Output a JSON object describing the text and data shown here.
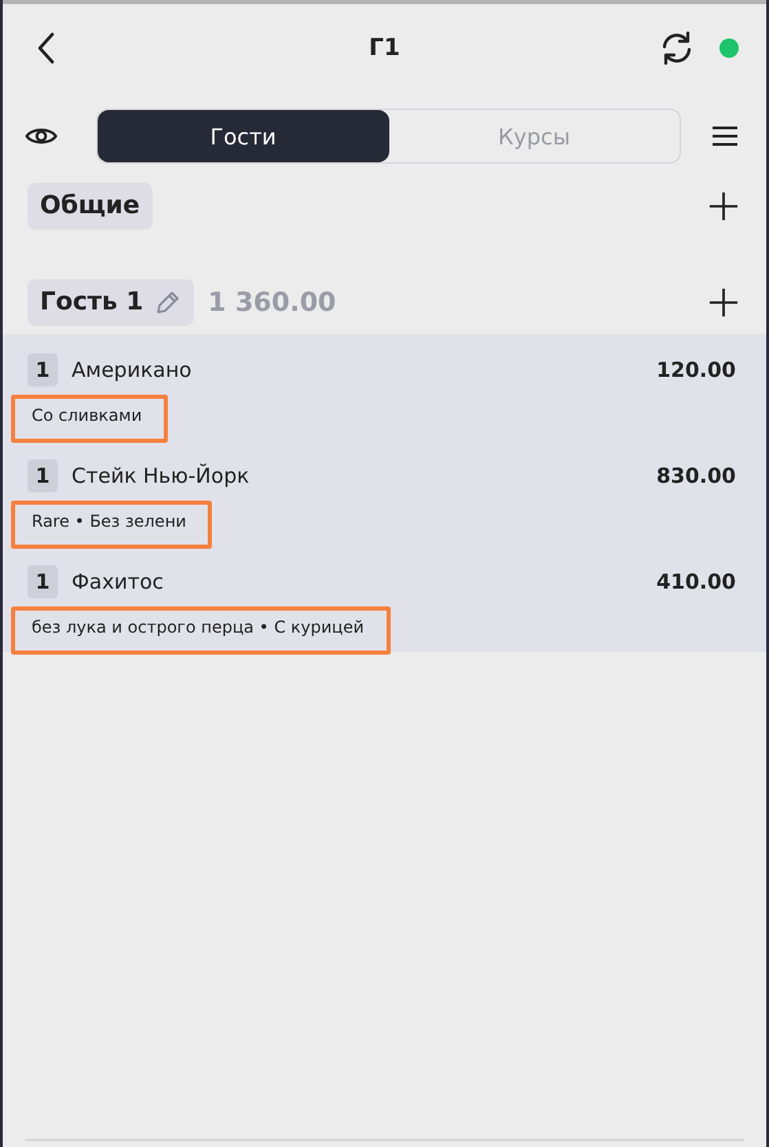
{
  "header": {
    "title": "Г1",
    "online": true
  },
  "tabs": [
    {
      "label": "Гости",
      "selected": true
    },
    {
      "label": "Курсы",
      "selected": false
    }
  ],
  "common": {
    "label": "Общие"
  },
  "guest": {
    "name": "Гость 1",
    "total": "1 360.00"
  },
  "items": [
    {
      "qty": "1",
      "name": "Американо",
      "price": "120.00",
      "modifiers": "Со сливками",
      "highlighted": true
    },
    {
      "qty": "1",
      "name": "Стейк Нью-Йорк",
      "price": "830.00",
      "modifiers": "Rare  •  Без зелени",
      "highlighted": true
    },
    {
      "qty": "1",
      "name": "Фахитос",
      "price": "410.00",
      "modifiers": "без лука и острого перца  •  С курицей",
      "highlighted": true
    }
  ]
}
